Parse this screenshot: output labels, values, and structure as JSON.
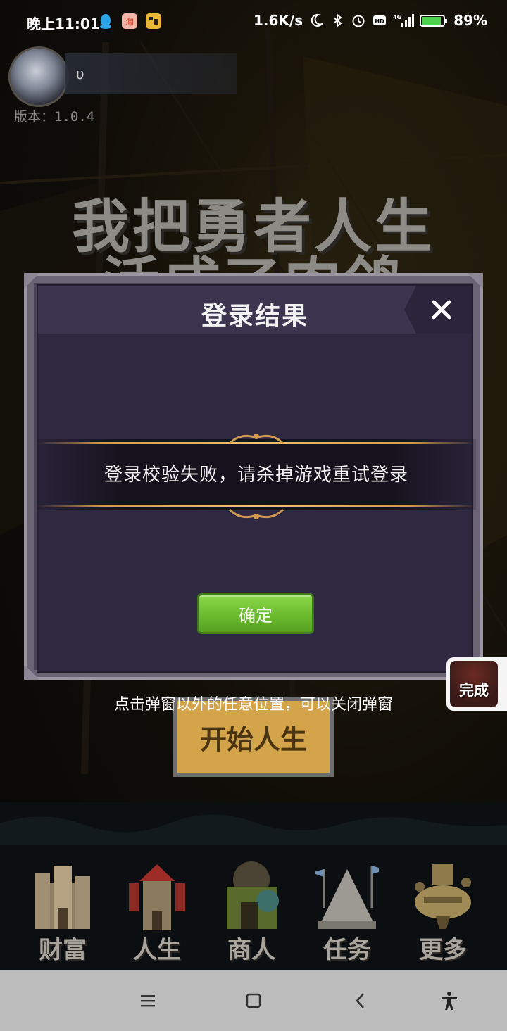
{
  "status_bar": {
    "time": "晚上11:01",
    "net_speed": "1.6K/s",
    "battery": "89%",
    "app_icons": [
      "qq-icon",
      "taobao-icon",
      "pixel-app-icon"
    ],
    "system_icons": [
      "moon-icon",
      "bluetooth-icon",
      "alarm-icon",
      "hd-icon",
      "signal-4g-icon",
      "battery-icon"
    ]
  },
  "profile": {
    "name": " υ",
    "version": "版本：1.0.4"
  },
  "game_title": {
    "line1": "我把勇者人生",
    "line2": "活成了肉鸽"
  },
  "dialog": {
    "title": "登录结果",
    "message": "登录校验失败，请杀掉游戏重试登录",
    "confirm_label": "确定",
    "close_icon": "close-icon"
  },
  "hint": "点击弹窗以外的任意位置，可以关闭弹窗",
  "start_button": "开始人生",
  "done_widget": "完成",
  "bottom_nav": [
    {
      "label": "财富",
      "icon": "castle-icon"
    },
    {
      "label": "人生",
      "icon": "tower-icon"
    },
    {
      "label": "商人",
      "icon": "merchant-hut-icon"
    },
    {
      "label": "任务",
      "icon": "pyramid-icon"
    },
    {
      "label": "更多",
      "icon": "airship-icon"
    }
  ],
  "system_nav": [
    "menu-icon",
    "home-icon",
    "back-icon",
    "accessibility-icon"
  ],
  "colors": {
    "dialog_bg": "#2e2840",
    "dialog_header": "#3b3550",
    "confirm_green": "#6bbb2e",
    "gold_line": "#d49a52"
  }
}
